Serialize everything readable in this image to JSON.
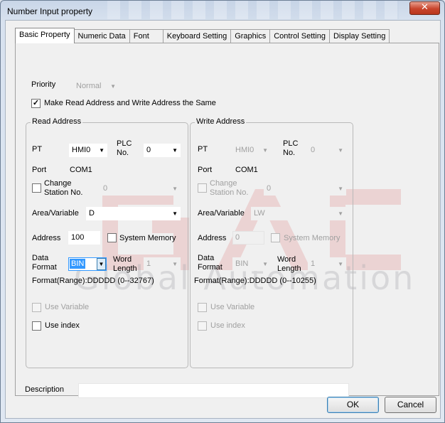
{
  "window": {
    "title": "Number Input property",
    "close_glyph": "✕"
  },
  "tabs": [
    {
      "label": "Basic Property"
    },
    {
      "label": "Numeric Data"
    },
    {
      "label": "Font"
    },
    {
      "label": "Keyboard Setting"
    },
    {
      "label": "Graphics"
    },
    {
      "label": "Control Setting"
    },
    {
      "label": "Display Setting"
    }
  ],
  "priority": {
    "label": "Priority",
    "value": "Normal"
  },
  "same_address": {
    "label": "Make Read Address and Write Address the Same",
    "checked": true
  },
  "read": {
    "title": "Read Address",
    "pt_label": "PT",
    "pt_value": "HMI0",
    "plc_label": "PLC\nNo.",
    "plc_label_1": "PLC",
    "plc_label_2": "No.",
    "plc_value": "0",
    "port_label": "Port",
    "port_value": "COM1",
    "change_station_1": "Change",
    "change_station_2": "Station No.",
    "station_value": "0",
    "area_label": "Area/Variable",
    "area_value": "D",
    "address_label": "Address",
    "address_value": "100",
    "system_memory": "System Memory",
    "data_format_1": "Data",
    "data_format_2": "Format",
    "data_format_value": "BIN",
    "word_length_1": "Word",
    "word_length_2": "Length",
    "word_length_value": "1",
    "format_range": "Format(Range):DDDDD (0--32767)",
    "use_variable": "Use Variable",
    "use_index": "Use index"
  },
  "write": {
    "title": "Write Address",
    "pt_label": "PT",
    "pt_value": "HMI0",
    "plc_label_1": "PLC",
    "plc_label_2": "No.",
    "plc_value": "0",
    "port_label": "Port",
    "port_value": "COM1",
    "change_station_1": "Change",
    "change_station_2": "Station No.",
    "station_value": "0",
    "area_label": "Area/Variable",
    "area_value": "LW",
    "address_label": "Address",
    "address_value": "0",
    "system_memory": "System Memory",
    "data_format_1": "Data",
    "data_format_2": "Format",
    "data_format_value": "BIN",
    "word_length_1": "Word",
    "word_length_2": "Length",
    "word_length_value": "1",
    "format_range": "Format(Range):DDDDD (0--10255)",
    "use_variable": "Use Variable",
    "use_index": "Use index"
  },
  "description": {
    "label": "Description",
    "value": ""
  },
  "buttons": {
    "ok": "OK",
    "cancel": "Cancel"
  },
  "watermark": {
    "logo": "GAC",
    "text": "Global Automation"
  },
  "colors": {
    "accent_red": "#c8452c",
    "selection": "#3399ff",
    "watermark_red": "#e8b4b4"
  }
}
